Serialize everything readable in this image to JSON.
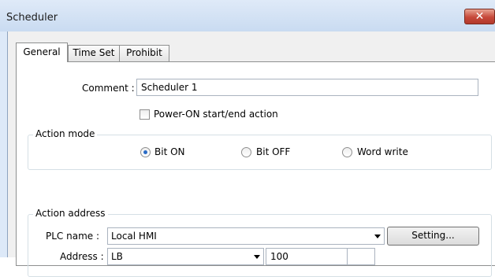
{
  "window": {
    "title": "Scheduler",
    "close_glyph": "✕"
  },
  "tabs": [
    {
      "label": "General"
    },
    {
      "label": "Time Set"
    },
    {
      "label": "Prohibit"
    }
  ],
  "general": {
    "comment_label": "Comment :",
    "comment_value": "Scheduler 1",
    "power_on_label": "Power-ON start/end action",
    "power_on_checked": false
  },
  "action_mode": {
    "title": "Action mode",
    "options": [
      {
        "label": "Bit ON"
      },
      {
        "label": "Bit OFF"
      },
      {
        "label": "Word write"
      }
    ],
    "selected": "Bit ON"
  },
  "action_address": {
    "title": "Action address",
    "plc_label": "PLC name :",
    "plc_value": "Local HMI",
    "setting_label": "Setting...",
    "address_label": "Address :",
    "device_value": "LB",
    "address_value": "100"
  }
}
